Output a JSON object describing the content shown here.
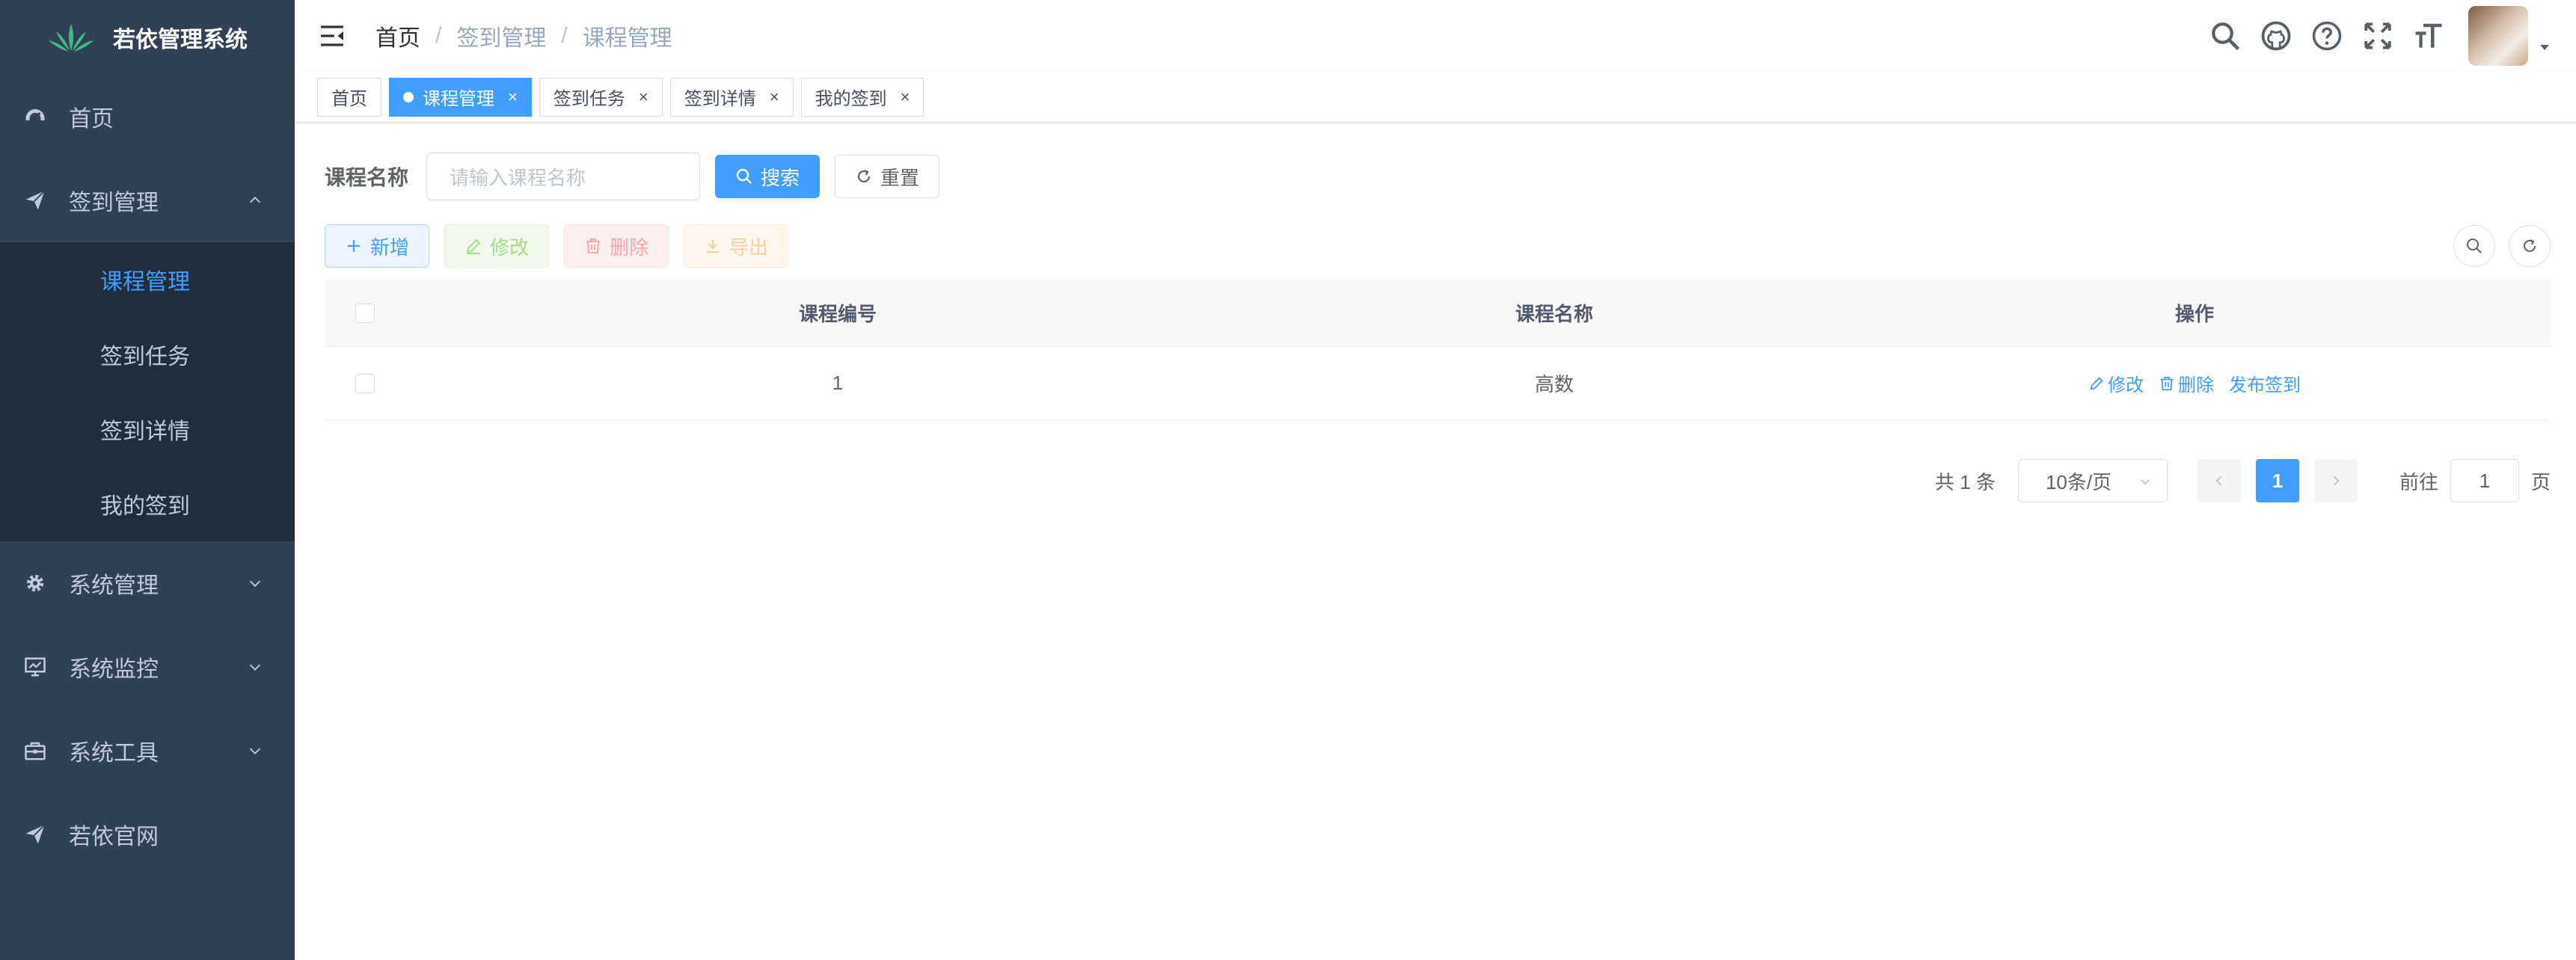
{
  "app": {
    "title": "若依管理系统"
  },
  "sidebar": {
    "items": [
      {
        "label": "首页",
        "icon": "dashboard-icon"
      },
      {
        "label": "签到管理",
        "icon": "send-icon",
        "expanded": true,
        "children": [
          {
            "label": "课程管理",
            "active": true
          },
          {
            "label": "签到任务"
          },
          {
            "label": "签到详情"
          },
          {
            "label": "我的签到"
          }
        ]
      },
      {
        "label": "系统管理",
        "icon": "gear-icon"
      },
      {
        "label": "系统监控",
        "icon": "monitor-icon"
      },
      {
        "label": "系统工具",
        "icon": "toolbox-icon"
      },
      {
        "label": "若依官网",
        "icon": "send-icon"
      }
    ]
  },
  "breadcrumb": [
    "首页",
    "签到管理",
    "课程管理"
  ],
  "tags": [
    {
      "label": "首页"
    },
    {
      "label": "课程管理",
      "active": true
    },
    {
      "label": "签到任务"
    },
    {
      "label": "签到详情"
    },
    {
      "label": "我的签到"
    }
  ],
  "tag_close": "×",
  "search": {
    "label": "课程名称",
    "placeholder": "请输入课程名称",
    "search_btn": "搜索",
    "reset_btn": "重置"
  },
  "toolbar": {
    "add": "新增",
    "edit": "修改",
    "delete": "删除",
    "export": "导出"
  },
  "table": {
    "headers": [
      "课程编号",
      "课程名称",
      "操作"
    ],
    "rows": [
      {
        "id": "1",
        "name": "高数",
        "ops": [
          "修改",
          "删除",
          "发布签到"
        ]
      }
    ]
  },
  "pagination": {
    "total": "共 1 条",
    "page_size": "10条/页",
    "current": "1",
    "goto_label": "前往",
    "goto_value": "1",
    "page_suffix": "页"
  },
  "colors": {
    "sidebar_bg": "#304156",
    "submenu_bg": "#1f2d3d",
    "primary": "#409eff"
  }
}
